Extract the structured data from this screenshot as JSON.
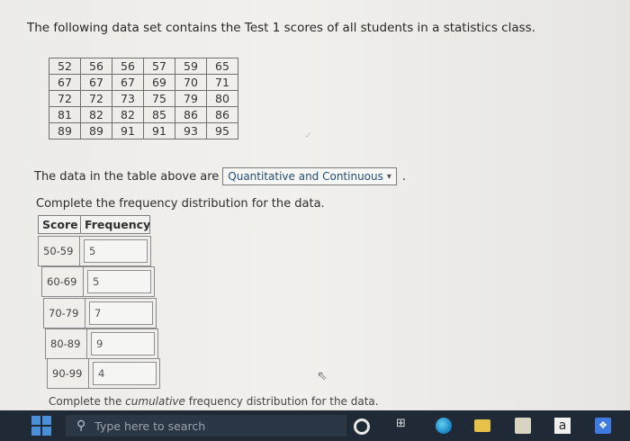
{
  "question": {
    "intro": "The following data set contains the Test 1 scores of all students in a statistics class.",
    "data_table": [
      [
        "52",
        "56",
        "56",
        "57",
        "59",
        "65"
      ],
      [
        "67",
        "67",
        "67",
        "69",
        "70",
        "71"
      ],
      [
        "72",
        "72",
        "73",
        "75",
        "79",
        "80"
      ],
      [
        "81",
        "82",
        "82",
        "85",
        "86",
        "86"
      ],
      [
        "89",
        "89",
        "91",
        "91",
        "93",
        "95"
      ]
    ],
    "data_type": {
      "prefix": "The data in the table above are",
      "selected": "Quantitative and Continuous",
      "suffix": "."
    },
    "frequency": {
      "instruction": "Complete the frequency distribution for the data.",
      "header_score": "Score",
      "header_frequency": "Frequency",
      "rows": [
        {
          "score": "50-59",
          "value": "5"
        },
        {
          "score": "60-69",
          "value": "5"
        },
        {
          "score": "70-79",
          "value": "7"
        },
        {
          "score": "80-89",
          "value": "9"
        },
        {
          "score": "90-99",
          "value": "4"
        }
      ]
    },
    "cumulative": {
      "before": "Complete the",
      "italic": "cumulative",
      "after": "frequency distribution for the data."
    }
  },
  "taskbar": {
    "search_placeholder": "Type here to search",
    "icons": [
      "windows-start-icon",
      "search-icon",
      "cortana-icon",
      "task-view-icon",
      "edge-icon",
      "file-explorer-icon",
      "store-icon",
      "word-app-icon",
      "dropbox-icon"
    ],
    "word_glyph": "a"
  }
}
